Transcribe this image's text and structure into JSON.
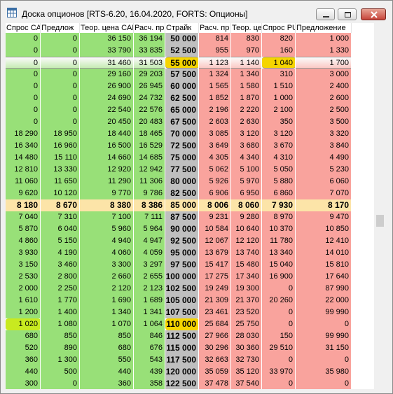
{
  "window": {
    "title": "Доска опционов [RTS-6.20, 16.04.2020, FORTS: Опционы]",
    "icon": "grid-app-icon",
    "buttons": [
      "minimize-icon",
      "maximize-icon",
      "close-icon"
    ]
  },
  "colors": {
    "call": "#98e078",
    "strike": "#bfbfbf",
    "put": "#f9a39d",
    "atm_row": "#fce4a8",
    "highlight": "#f5d500"
  },
  "table": {
    "columns": [
      "Спрос CALL",
      "Предложение CALL",
      "Теор. цена CALL",
      "Расч. пр",
      "Страйк",
      "Расч. пр",
      "Теор. це",
      "Спрос PUT",
      "Предложение"
    ],
    "column_display": [
      "Спрос CA",
      "Предлож",
      "Теор. цена CAL",
      "Расч. пр",
      "Страйк",
      "Расч. пр",
      "Теор. це",
      "Спрос PUT",
      "Предложение"
    ],
    "rows": [
      {
        "c_bid": "0",
        "c_ask": "0",
        "c_theo": "36 150",
        "c_calc": "36 194",
        "strike": "50 000",
        "p_calc": "814",
        "p_theo": "830",
        "p_bid": "820",
        "p_ask": "1 000"
      },
      {
        "c_bid": "0",
        "c_ask": "0",
        "c_theo": "33 790",
        "c_calc": "33 835",
        "strike": "52 500",
        "p_calc": "955",
        "p_theo": "970",
        "p_bid": "160",
        "p_ask": "1 330"
      },
      {
        "c_bid": "0",
        "c_ask": "0",
        "c_theo": "31 460",
        "c_calc": "31 503",
        "strike": "55 000",
        "p_calc": "1 123",
        "p_theo": "1 140",
        "p_bid": "1 040",
        "p_ask": "1 700",
        "state": "selected"
      },
      {
        "c_bid": "0",
        "c_ask": "0",
        "c_theo": "29 160",
        "c_calc": "29 203",
        "strike": "57 500",
        "p_calc": "1 324",
        "p_theo": "1 340",
        "p_bid": "310",
        "p_ask": "3 000"
      },
      {
        "c_bid": "0",
        "c_ask": "0",
        "c_theo": "26 900",
        "c_calc": "26 945",
        "strike": "60 000",
        "p_calc": "1 565",
        "p_theo": "1 580",
        "p_bid": "1 510",
        "p_ask": "2 400"
      },
      {
        "c_bid": "0",
        "c_ask": "0",
        "c_theo": "24 690",
        "c_calc": "24 732",
        "strike": "62 500",
        "p_calc": "1 852",
        "p_theo": "1 870",
        "p_bid": "1 000",
        "p_ask": "2 600"
      },
      {
        "c_bid": "0",
        "c_ask": "0",
        "c_theo": "22 540",
        "c_calc": "22 576",
        "strike": "65 000",
        "p_calc": "2 196",
        "p_theo": "2 220",
        "p_bid": "2 100",
        "p_ask": "2 500"
      },
      {
        "c_bid": "0",
        "c_ask": "0",
        "c_theo": "20 450",
        "c_calc": "20 483",
        "strike": "67 500",
        "p_calc": "2 603",
        "p_theo": "2 630",
        "p_bid": "350",
        "p_ask": "3 500"
      },
      {
        "c_bid": "18 290",
        "c_ask": "18 950",
        "c_theo": "18 440",
        "c_calc": "18 465",
        "strike": "70 000",
        "p_calc": "3 085",
        "p_theo": "3 120",
        "p_bid": "3 120",
        "p_ask": "3 320"
      },
      {
        "c_bid": "16 340",
        "c_ask": "16 960",
        "c_theo": "16 500",
        "c_calc": "16 529",
        "strike": "72 500",
        "p_calc": "3 649",
        "p_theo": "3 680",
        "p_bid": "3 670",
        "p_ask": "3 840"
      },
      {
        "c_bid": "14 480",
        "c_ask": "15 110",
        "c_theo": "14 660",
        "c_calc": "14 685",
        "strike": "75 000",
        "p_calc": "4 305",
        "p_theo": "4 340",
        "p_bid": "4 310",
        "p_ask": "4 490"
      },
      {
        "c_bid": "12 810",
        "c_ask": "13 330",
        "c_theo": "12 920",
        "c_calc": "12 942",
        "strike": "77 500",
        "p_calc": "5 062",
        "p_theo": "5 100",
        "p_bid": "5 050",
        "p_ask": "5 230"
      },
      {
        "c_bid": "11 060",
        "c_ask": "11 650",
        "c_theo": "11 290",
        "c_calc": "11 306",
        "strike": "80 000",
        "p_calc": "5 926",
        "p_theo": "5 970",
        "p_bid": "5 880",
        "p_ask": "6 060"
      },
      {
        "c_bid": "9 620",
        "c_ask": "10 120",
        "c_theo": "9 770",
        "c_calc": "9 786",
        "strike": "82 500",
        "p_calc": "6 906",
        "p_theo": "6 950",
        "p_bid": "6 860",
        "p_ask": "7 070"
      },
      {
        "c_bid": "8 180",
        "c_ask": "8 670",
        "c_theo": "8 380",
        "c_calc": "8 386",
        "strike": "85 000",
        "p_calc": "8 006",
        "p_theo": "8 060",
        "p_bid": "7 930",
        "p_ask": "8 170",
        "state": "atm"
      },
      {
        "c_bid": "7 040",
        "c_ask": "7 310",
        "c_theo": "7 100",
        "c_calc": "7 111",
        "strike": "87 500",
        "p_calc": "9 231",
        "p_theo": "9 280",
        "p_bid": "8 970",
        "p_ask": "9 470"
      },
      {
        "c_bid": "5 870",
        "c_ask": "6 040",
        "c_theo": "5 960",
        "c_calc": "5 964",
        "strike": "90 000",
        "p_calc": "10 584",
        "p_theo": "10 640",
        "p_bid": "10 370",
        "p_ask": "10 850"
      },
      {
        "c_bid": "4 860",
        "c_ask": "5 150",
        "c_theo": "4 940",
        "c_calc": "4 947",
        "strike": "92 500",
        "p_calc": "12 067",
        "p_theo": "12 120",
        "p_bid": "11 780",
        "p_ask": "12 410"
      },
      {
        "c_bid": "3 930",
        "c_ask": "4 190",
        "c_theo": "4 060",
        "c_calc": "4 059",
        "strike": "95 000",
        "p_calc": "13 679",
        "p_theo": "13 740",
        "p_bid": "13 340",
        "p_ask": "14 010"
      },
      {
        "c_bid": "3 150",
        "c_ask": "3 460",
        "c_theo": "3 300",
        "c_calc": "3 297",
        "strike": "97 500",
        "p_calc": "15 417",
        "p_theo": "15 480",
        "p_bid": "15 040",
        "p_ask": "15 810"
      },
      {
        "c_bid": "2 530",
        "c_ask": "2 800",
        "c_theo": "2 660",
        "c_calc": "2 655",
        "strike": "100 000",
        "p_calc": "17 275",
        "p_theo": "17 340",
        "p_bid": "16 900",
        "p_ask": "17 640"
      },
      {
        "c_bid": "2 000",
        "c_ask": "2 250",
        "c_theo": "2 120",
        "c_calc": "2 123",
        "strike": "102 500",
        "p_calc": "19 249",
        "p_theo": "19 300",
        "p_bid": "0",
        "p_ask": "87 990"
      },
      {
        "c_bid": "1 610",
        "c_ask": "1 770",
        "c_theo": "1 690",
        "c_calc": "1 689",
        "strike": "105 000",
        "p_calc": "21 309",
        "p_theo": "21 370",
        "p_bid": "20 260",
        "p_ask": "22 000"
      },
      {
        "c_bid": "1 200",
        "c_ask": "1 400",
        "c_theo": "1 340",
        "c_calc": "1 341",
        "strike": "107 500",
        "p_calc": "23 461",
        "p_theo": "23 520",
        "p_bid": "0",
        "p_ask": "99 990"
      },
      {
        "c_bid": "1 020",
        "c_ask": "1 080",
        "c_theo": "1 070",
        "c_calc": "1 064",
        "strike": "110 000",
        "p_calc": "25 684",
        "p_theo": "25 750",
        "p_bid": "0",
        "p_ask": "0"
      },
      {
        "c_bid": "680",
        "c_ask": "850",
        "c_theo": "850",
        "c_calc": "846",
        "strike": "112 500",
        "p_calc": "27 966",
        "p_theo": "28 030",
        "p_bid": "150",
        "p_ask": "99 990"
      },
      {
        "c_bid": "520",
        "c_ask": "890",
        "c_theo": "680",
        "c_calc": "676",
        "strike": "115 000",
        "p_calc": "30 296",
        "p_theo": "30 360",
        "p_bid": "29 510",
        "p_ask": "31 150"
      },
      {
        "c_bid": "360",
        "c_ask": "1 300",
        "c_theo": "550",
        "c_calc": "543",
        "strike": "117 500",
        "p_calc": "32 663",
        "p_theo": "32 730",
        "p_bid": "0",
        "p_ask": "0"
      },
      {
        "c_bid": "440",
        "c_ask": "500",
        "c_theo": "440",
        "c_calc": "439",
        "strike": "120 000",
        "p_calc": "35 059",
        "p_theo": "35 120",
        "p_bid": "33 970",
        "p_ask": "35 980"
      },
      {
        "c_bid": "300",
        "c_ask": "0",
        "c_theo": "360",
        "c_calc": "358",
        "strike": "122 500",
        "p_calc": "37 478",
        "p_theo": "37 540",
        "p_bid": "0",
        "p_ask": "0"
      }
    ],
    "highlighted_cells": [
      {
        "row": 2,
        "column": "strike"
      },
      {
        "row": 2,
        "column": "p_bid"
      },
      {
        "row": 24,
        "column": "c_bid"
      },
      {
        "row": 24,
        "column": "strike"
      }
    ]
  }
}
